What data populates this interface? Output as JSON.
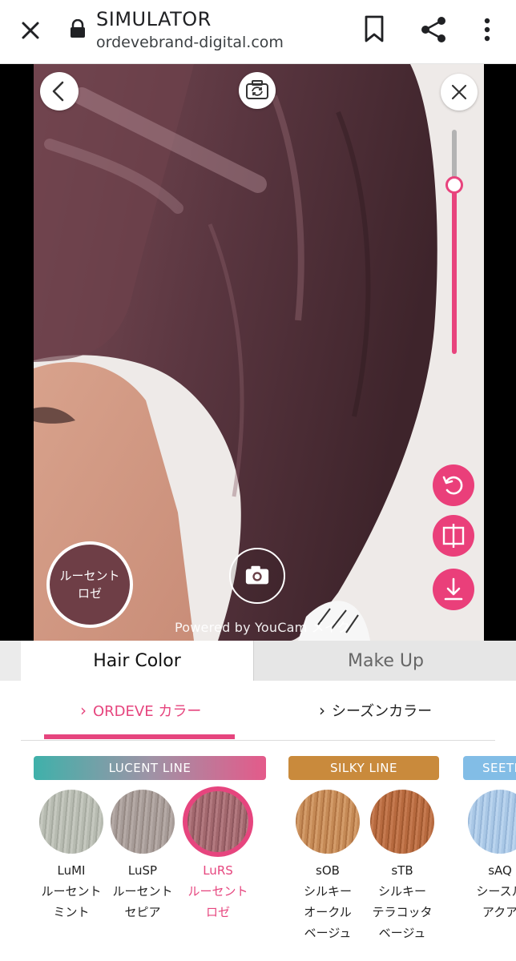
{
  "browser": {
    "title": "SIMULATOR",
    "url": "ordevebrand-digital.com"
  },
  "camera": {
    "selected_color_line1": "ルーセント",
    "selected_color_line2": "ロゼ",
    "powered_by": "Powered by YouCam メイク",
    "intensity_level": 0.79
  },
  "tabs": {
    "hair_color": "Hair Color",
    "make_up": "Make Up"
  },
  "subtabs": {
    "ordeve": "ORDEVE カラー",
    "season": "シーズンカラー"
  },
  "lines": {
    "lucent": "LUCENT LINE",
    "silky": "SILKY LINE",
    "seeth": "SEETH"
  },
  "swatches": [
    {
      "code": "LuMI",
      "line1": "ルーセント",
      "line2": "ミント",
      "line3": "",
      "color": "#b3b7ad"
    },
    {
      "code": "LuSP",
      "line1": "ルーセント",
      "line2": "セピア",
      "line3": "",
      "color": "#a2968f"
    },
    {
      "code": "LuRS",
      "line1": "ルーセント",
      "line2": "ロゼ",
      "line3": "",
      "color": "#9c6268"
    },
    {
      "code": "sOB",
      "line1": "シルキー",
      "line2": "オークル",
      "line3": "ベージュ",
      "color": "#c0854f"
    },
    {
      "code": "sTB",
      "line1": "シルキー",
      "line2": "テラコッタ",
      "line3": "ベージュ",
      "color": "#b26640"
    },
    {
      "code": "sAQ",
      "line1": "シースル",
      "line2": "アクア",
      "line3": "",
      "color": "#a4c4e4"
    }
  ],
  "colors": {
    "accent_pink": "#e6457e",
    "selected_hair": "#6e3e46"
  }
}
